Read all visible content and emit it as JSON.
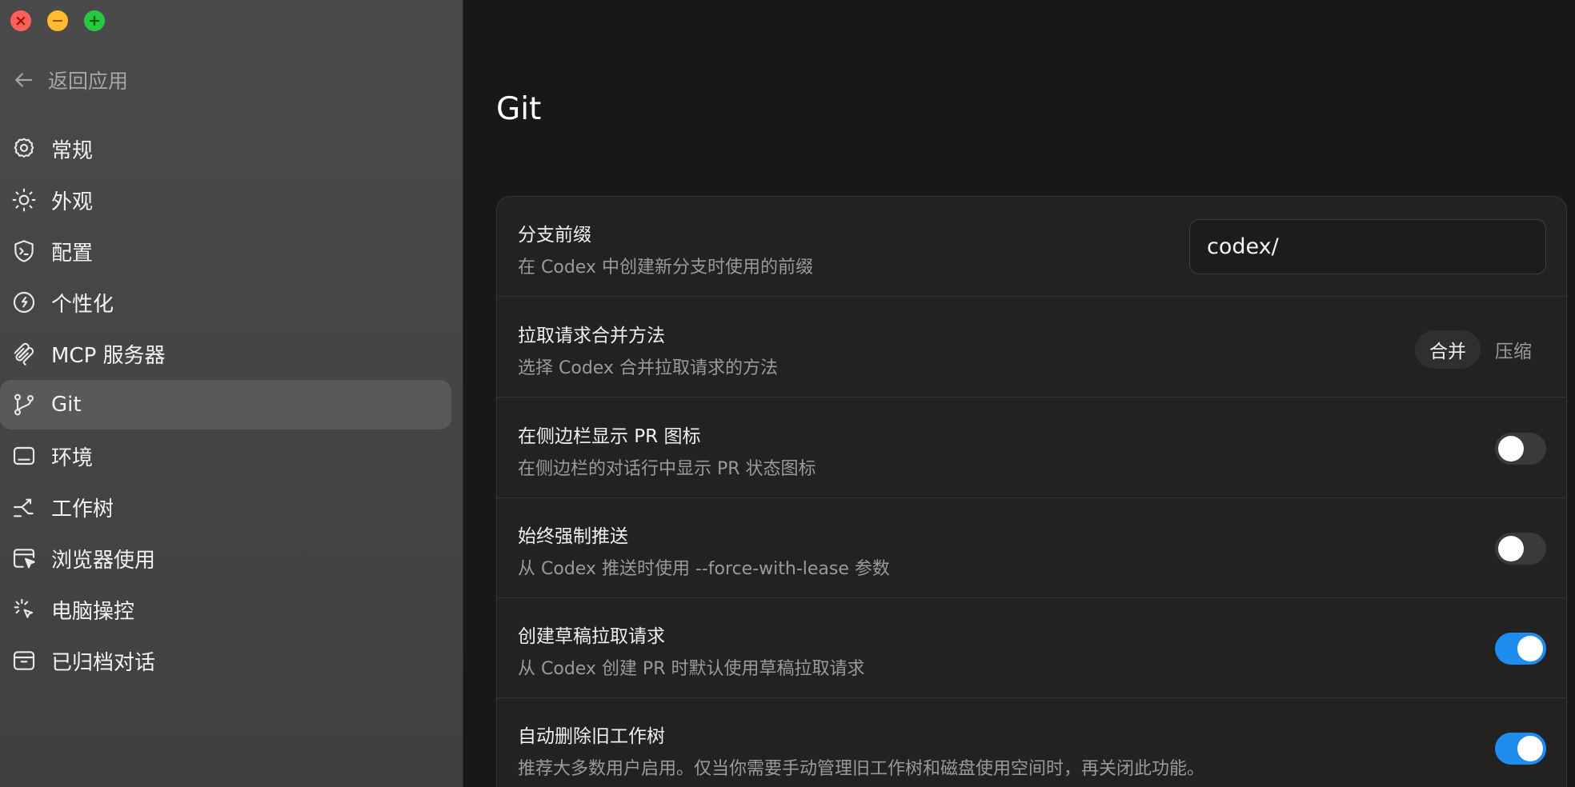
{
  "window": {
    "traffic_lights": {
      "close": "×",
      "minimize": "−",
      "maximize": "+"
    }
  },
  "sidebar": {
    "back_label": "返回应用",
    "items": [
      {
        "label": "常规",
        "icon": "gear-icon"
      },
      {
        "label": "外观",
        "icon": "sun-icon"
      },
      {
        "label": "配置",
        "icon": "shield-terminal-icon"
      },
      {
        "label": "个性化",
        "icon": "personalization-icon"
      },
      {
        "label": "MCP 服务器",
        "icon": "mcp-icon"
      },
      {
        "label": "Git",
        "icon": "git-branch-icon",
        "active": true
      },
      {
        "label": "环境",
        "icon": "environment-icon"
      },
      {
        "label": "工作树",
        "icon": "worktree-icon"
      },
      {
        "label": "浏览器使用",
        "icon": "browser-cursor-icon"
      },
      {
        "label": "电脑操控",
        "icon": "computer-control-icon"
      },
      {
        "label": "已归档对话",
        "icon": "archive-icon"
      }
    ]
  },
  "main": {
    "title": "Git",
    "settings": [
      {
        "title": "分支前缀",
        "description": "在 Codex 中创建新分支时使用的前缀",
        "control": "text",
        "value": "codex/"
      },
      {
        "title": "拉取请求合并方法",
        "description": "选择 Codex 合并拉取请求的方法",
        "control": "segmented",
        "options": [
          "合并",
          "压缩"
        ],
        "selected": "合并"
      },
      {
        "title": "在侧边栏显示 PR 图标",
        "description": "在侧边栏的对话行中显示 PR 状态图标",
        "control": "toggle",
        "on": false
      },
      {
        "title": "始终强制推送",
        "description": "从 Codex 推送时使用 --force-with-lease 参数",
        "control": "toggle",
        "on": false
      },
      {
        "title": "创建草稿拉取请求",
        "description": "从 Codex 创建 PR 时默认使用草稿拉取请求",
        "control": "toggle",
        "on": true
      },
      {
        "title": "自动删除旧工作树",
        "description": "推荐大多数用户启用。仅当你需要手动管理旧工作树和磁盘使用空间时，再关闭此功能。",
        "control": "toggle",
        "on": true
      }
    ]
  },
  "colors": {
    "accent": "#1f8cf0",
    "sidebar_bg": "#464646",
    "main_bg": "#181818",
    "card_bg": "#222222"
  }
}
